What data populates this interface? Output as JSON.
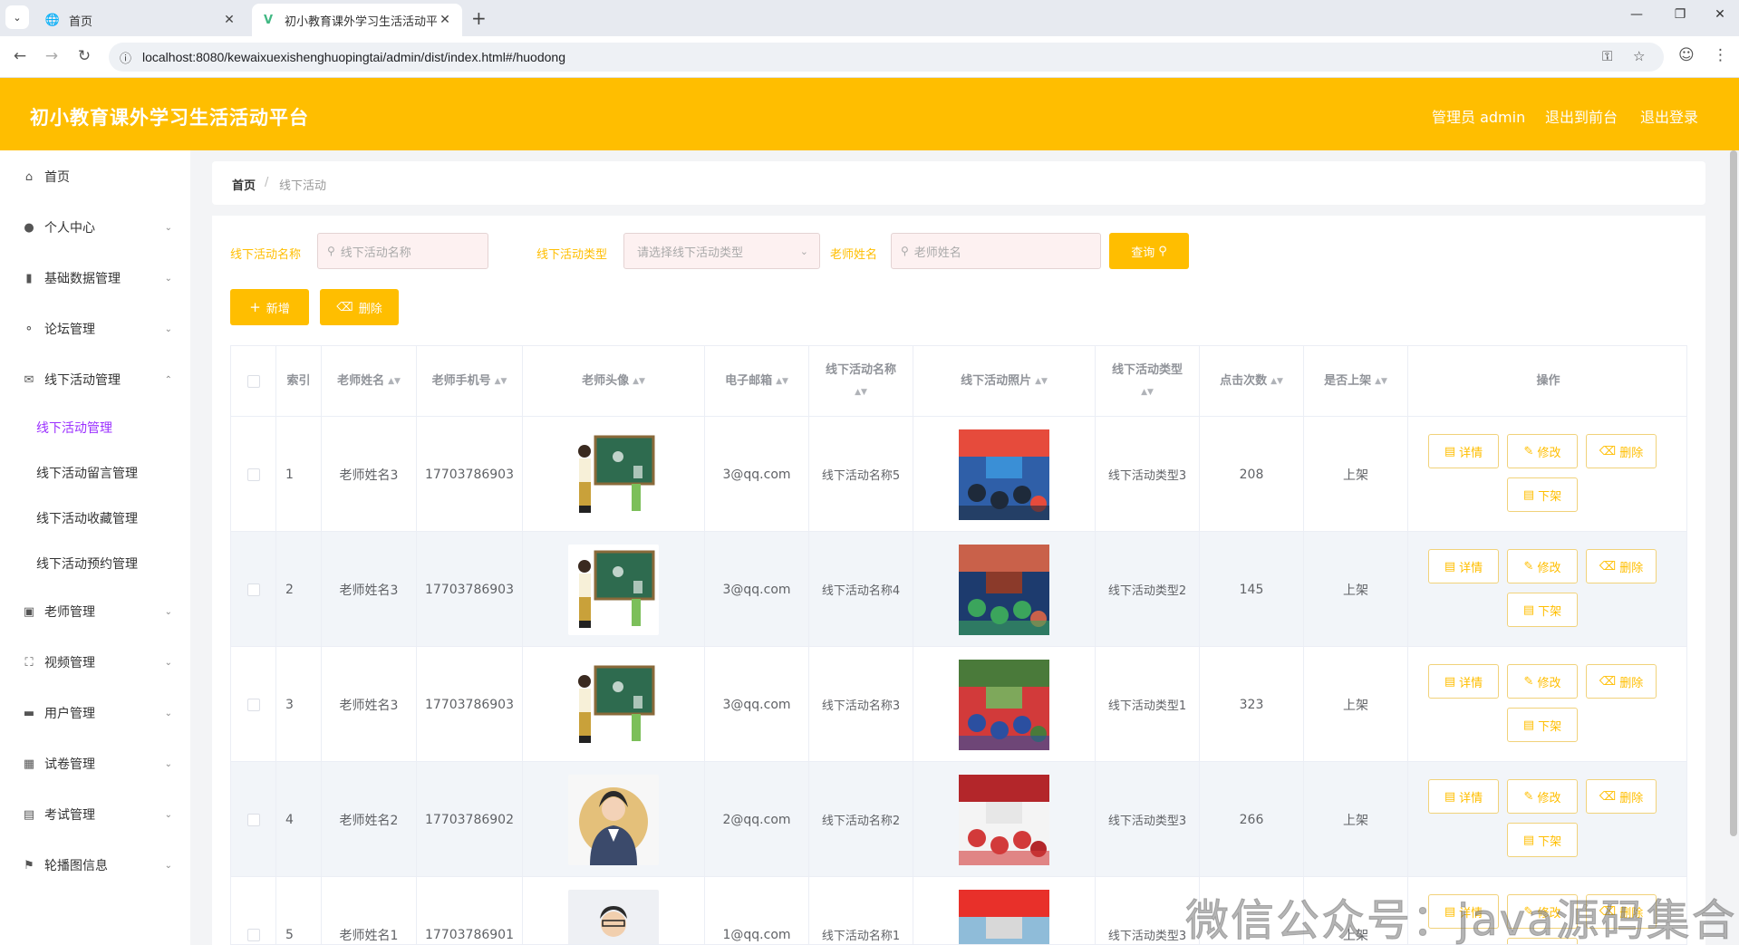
{
  "browser": {
    "tabs": [
      {
        "label": "首页",
        "active": false
      },
      {
        "label": "初小教育课外学习生活活动平台",
        "active": true
      }
    ],
    "url": "localhost:8080/kewaixuexishenghuopingtai/admin/dist/index.html#/huodong"
  },
  "header": {
    "title": "初小教育课外学习生活活动平台",
    "user": "管理员 admin",
    "to_front": "退出到前台",
    "logout": "退出登录"
  },
  "sidebar": {
    "items": [
      {
        "label": "首页",
        "icon": "home-icon"
      },
      {
        "label": "个人中心",
        "icon": "user-icon"
      },
      {
        "label": "基础数据管理",
        "icon": "data-icon"
      },
      {
        "label": "论坛管理",
        "icon": "mic-icon"
      },
      {
        "label": "线下活动管理",
        "icon": "mail-icon"
      },
      {
        "label": "老师管理",
        "icon": "teacher-icon"
      },
      {
        "label": "视频管理",
        "icon": "video-icon"
      },
      {
        "label": "用户管理",
        "icon": "users-icon"
      },
      {
        "label": "试卷管理",
        "icon": "grid-icon"
      },
      {
        "label": "考试管理",
        "icon": "chart-icon"
      },
      {
        "label": "轮播图信息",
        "icon": "flag-icon"
      }
    ],
    "sub_items": [
      {
        "label": "线下活动管理",
        "active": true
      },
      {
        "label": "线下活动留言管理",
        "active": false
      },
      {
        "label": "线下活动收藏管理",
        "active": false
      },
      {
        "label": "线下活动预约管理",
        "active": false
      }
    ]
  },
  "breadcrumb": {
    "home": "首页",
    "sep": "/",
    "current": "线下活动"
  },
  "filters": {
    "name_label": "线下活动名称",
    "name_placeholder": "线下活动名称",
    "type_label": "线下活动类型",
    "type_placeholder": "请选择线下活动类型",
    "teacher_label": "老师姓名",
    "teacher_placeholder": "老师姓名",
    "query_button": "查询"
  },
  "toolbar": {
    "add": "新增",
    "delete": "删除"
  },
  "table": {
    "headers": {
      "index": "索引",
      "teacher_name": "老师姓名",
      "phone": "老师手机号",
      "avatar": "老师头像",
      "email": "电子邮箱",
      "activity_name": "线下活动名称",
      "photo": "线下活动照片",
      "activity_type": "线下活动类型",
      "clicks": "点击次数",
      "on_shelf": "是否上架",
      "actions": "操作"
    },
    "actions": {
      "detail": "详情",
      "edit": "修改",
      "delete": "删除",
      "offshelf": "下架"
    },
    "rows": [
      {
        "index": "1",
        "teacher": "老师姓名3",
        "phone": "17703786903",
        "email": "3@qq.com",
        "name": "线下活动名称5",
        "type": "线下活动类型3",
        "clicks": "208",
        "status": "上架"
      },
      {
        "index": "2",
        "teacher": "老师姓名3",
        "phone": "17703786903",
        "email": "3@qq.com",
        "name": "线下活动名称4",
        "type": "线下活动类型2",
        "clicks": "145",
        "status": "上架"
      },
      {
        "index": "3",
        "teacher": "老师姓名3",
        "phone": "17703786903",
        "email": "3@qq.com",
        "name": "线下活动名称3",
        "type": "线下活动类型1",
        "clicks": "323",
        "status": "上架"
      },
      {
        "index": "4",
        "teacher": "老师姓名2",
        "phone": "17703786902",
        "email": "2@qq.com",
        "name": "线下活动名称2",
        "type": "线下活动类型3",
        "clicks": "266",
        "status": "上架"
      },
      {
        "index": "5",
        "teacher": "老师姓名1",
        "phone": "17703786901",
        "email": "1@qq.com",
        "name": "线下活动名称1",
        "type": "线下活动类型3",
        "clicks": "",
        "status": "上架"
      }
    ]
  },
  "watermark": "微信公众号：java源码集合",
  "colors": {
    "accent": "#ffbe00",
    "active_sub": "#9b30ff"
  }
}
